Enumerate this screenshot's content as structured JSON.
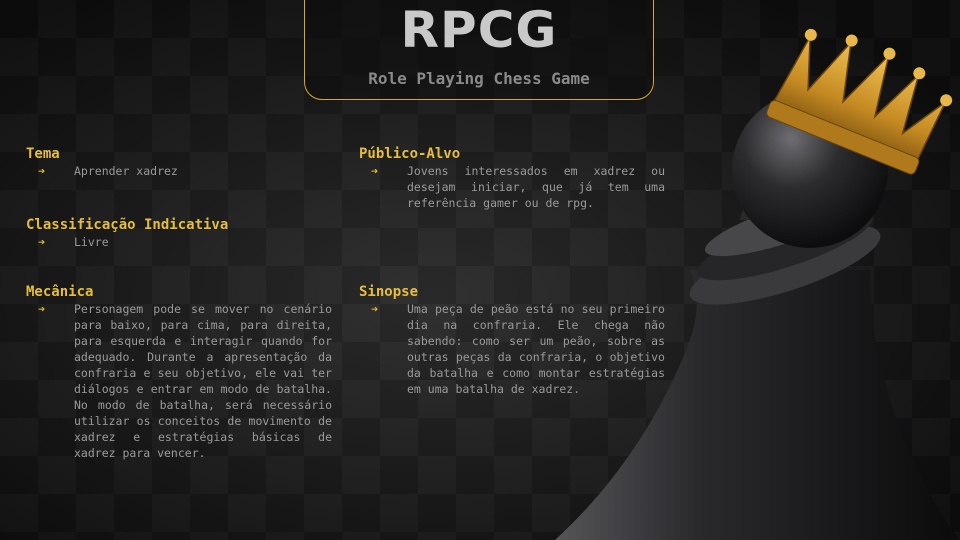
{
  "header": {
    "logo": "RPCG",
    "subtitle": "Role Playing Chess Game"
  },
  "sections": {
    "tema": {
      "title": "Tema",
      "text": "Aprender xadrez"
    },
    "classificacao": {
      "title": "Classificação Indicativa",
      "text": "Livre"
    },
    "mecanica": {
      "title": "Mecânica",
      "text": "Personagem pode se mover no cenário para baixo, para cima, para direita, para esquerda e interagir quando for adequado. Durante a apresentação da confraria e seu objetivo, ele vai ter diálogos e entrar em modo de batalha. No modo de batalha, será necessário utilizar os conceitos de movimento de xadrez e estratégias básicas de xadrez para vencer."
    },
    "publico": {
      "title": "Público-Alvo",
      "text": "Jovens interessados em xadrez ou desejam iniciar, que já tem uma referência  gamer ou de rpg."
    },
    "sinopse": {
      "title": "Sinopse",
      "text": "Uma peça de peão está no seu primeiro dia na confraria. Ele chega não sabendo: como ser um peão, sobre as outras peças da confraria, o objetivo da batalha e como montar estratégias em uma batalha de xadrez."
    }
  },
  "icons": {
    "bullet": "arrow-right-icon",
    "illustration": "crowned-pawn-icon"
  },
  "colors": {
    "accent": "#e6bd3c",
    "text": "#9a9a9a",
    "logo": "#c9c9c9",
    "background": "#1c1c1c"
  }
}
